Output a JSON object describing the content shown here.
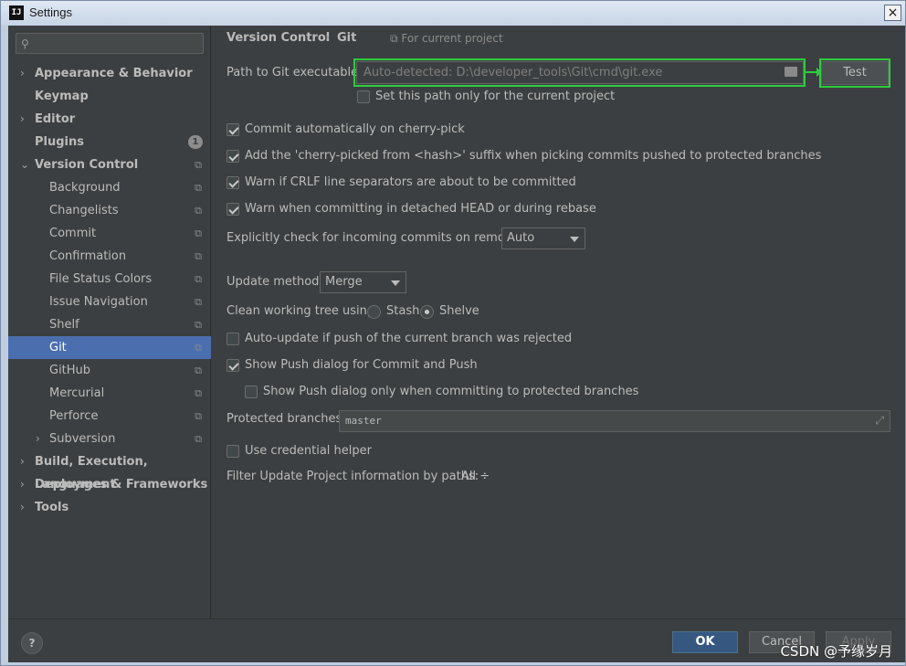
{
  "window": {
    "title": "Settings",
    "app_icon": "IJ",
    "close": "×"
  },
  "search": {
    "icon": "search-icon"
  },
  "sidebar": {
    "items": [
      {
        "label": "Appearance & Behavior",
        "arrow": "›"
      },
      {
        "label": "Keymap"
      },
      {
        "label": "Editor",
        "arrow": "›"
      },
      {
        "label": "Plugins",
        "badge": "1"
      },
      {
        "label": "Version Control",
        "arrow": "⌄"
      },
      {
        "label": "Background"
      },
      {
        "label": "Changelists"
      },
      {
        "label": "Commit"
      },
      {
        "label": "Confirmation"
      },
      {
        "label": "File Status Colors"
      },
      {
        "label": "Issue Navigation"
      },
      {
        "label": "Shelf"
      },
      {
        "label": "Git"
      },
      {
        "label": "GitHub"
      },
      {
        "label": "Mercurial"
      },
      {
        "label": "Perforce"
      },
      {
        "label": "Subversion",
        "arrow": "›"
      },
      {
        "label": "Build, Execution, Deployment",
        "arrow": "›"
      },
      {
        "label": "Languages & Frameworks",
        "arrow": "›"
      },
      {
        "label": "Tools",
        "arrow": "›"
      }
    ]
  },
  "breadcrumb": {
    "parent": "Version Control",
    "sep": "›",
    "current": "Git",
    "scope": "For current project"
  },
  "git": {
    "path_label": "Path to Git executable:",
    "path_value": "Auto-detected: D:\\developer_tools\\Git\\cmd\\git.exe",
    "test_label": "Test",
    "path_only_project": "Set this path only for the current project",
    "commit_cherry_pick": "Commit automatically on cherry-pick",
    "cherry_pick_suffix": "Add the 'cherry-picked from <hash>' suffix when picking commits pushed to protected branches",
    "warn_crlf": "Warn if CRLF line separators are about to be committed",
    "warn_detached": "Warn when committing in detached HEAD or during rebase",
    "incoming_label": "Explicitly check for incoming commits on remotes:",
    "incoming_value": "Auto",
    "update_method_label": "Update method:",
    "update_method_value": "Merge",
    "clean_tree_label": "Clean working tree using:",
    "stash_label": "Stash",
    "shelve_label": "Shelve",
    "auto_update_push": "Auto-update if push of the current branch was rejected",
    "show_push_dialog": "Show Push dialog for Commit and Push",
    "show_push_protected": "Show Push dialog only when committing to protected branches",
    "protected_label": "Protected branches:",
    "protected_value": "master",
    "credential_helper": "Use credential helper",
    "filter_label": "Filter Update Project information by paths:",
    "filter_value": "All ÷"
  },
  "footer": {
    "help": "?",
    "ok": "OK",
    "cancel": "Cancel",
    "apply": "Apply"
  },
  "watermark": "CSDN @予缘岁月",
  "colors": {
    "accent": "#4b6eaf",
    "highlight": "#2ecc40",
    "primary_button": "#365880"
  }
}
